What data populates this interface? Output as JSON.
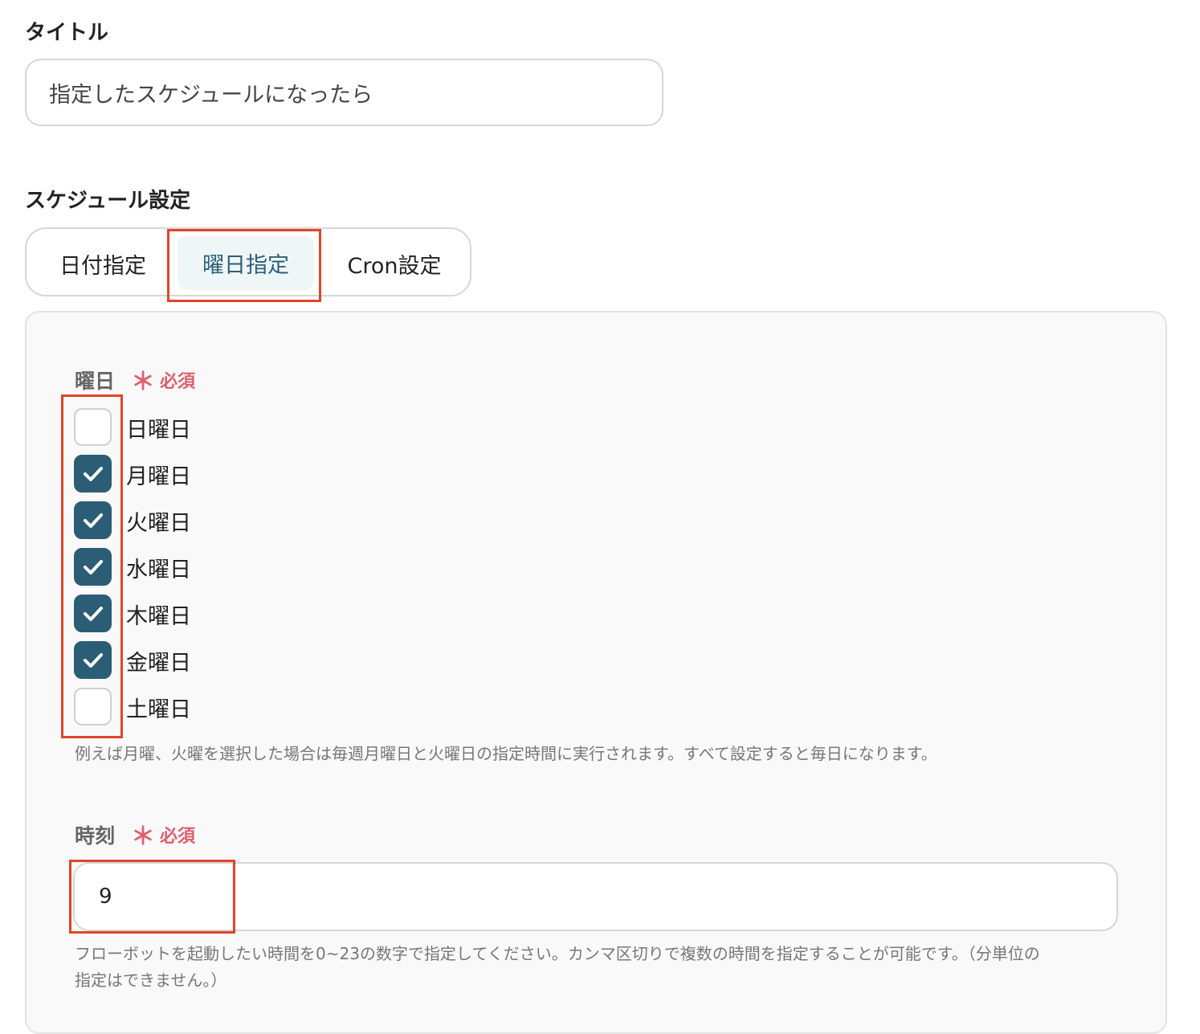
{
  "title_section": {
    "label": "タイトル",
    "value": "指定したスケジュールになったら"
  },
  "schedule_section": {
    "label": "スケジュール設定",
    "tabs": [
      {
        "label": "日付指定",
        "selected": false
      },
      {
        "label": "曜日指定",
        "selected": true
      },
      {
        "label": "Cron設定",
        "selected": false
      }
    ]
  },
  "weekday_field": {
    "label": "曜日",
    "required_mark": "＊",
    "required_text": "必須",
    "options": [
      {
        "label": "日曜日",
        "checked": false
      },
      {
        "label": "月曜日",
        "checked": true
      },
      {
        "label": "火曜日",
        "checked": true
      },
      {
        "label": "水曜日",
        "checked": true
      },
      {
        "label": "木曜日",
        "checked": true
      },
      {
        "label": "金曜日",
        "checked": true
      },
      {
        "label": "土曜日",
        "checked": false
      }
    ],
    "help": "例えば月曜、火曜を選択した場合は毎週月曜日と火曜日の指定時間に実行されます。すべて設定すると毎日になります。"
  },
  "time_field": {
    "label": "時刻",
    "required_mark": "＊",
    "required_text": "必須",
    "value": "9",
    "help_line1": "フローボットを起動したい時間を0~23の数字で指定してください。カンマ区切りで複数の時間を指定することが可能です。（分単位の",
    "help_line2": "指定はできません。）"
  },
  "colors": {
    "checkbox_checked": "#2c5d77",
    "highlight": "#e0452b",
    "required": "#e06070",
    "active_tab_bg": "#eef6f7",
    "active_tab_text": "#2e5f7a"
  },
  "icons": {
    "check": "checkmark-icon",
    "required": "asterisk-icon"
  }
}
